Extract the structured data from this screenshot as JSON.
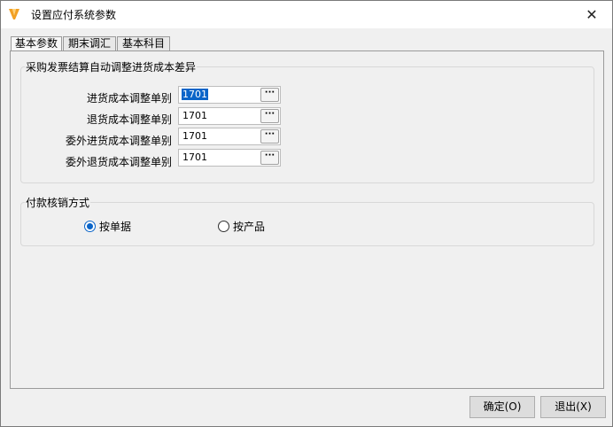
{
  "window": {
    "title": "设置应付系统参数",
    "close_glyph": "✕"
  },
  "tabs": [
    {
      "label": "基本参数",
      "active": true
    },
    {
      "label": "期末调汇",
      "active": false
    },
    {
      "label": "基本科目",
      "active": false
    }
  ],
  "invoice_group": {
    "title": "采购发票结算自动调整进货成本差异",
    "fields": [
      {
        "label": "进货成本调整单别",
        "value": "1701",
        "selected": true
      },
      {
        "label": "退货成本调整单别",
        "value": "1701",
        "selected": false
      },
      {
        "label": "委外进货成本调整单别",
        "value": "1701",
        "selected": false
      },
      {
        "label": "委外退货成本调整单别",
        "value": "1701",
        "selected": false
      }
    ],
    "browse_glyph": "···"
  },
  "payment_group": {
    "title": "付款核销方式",
    "options": [
      {
        "label": "按单据",
        "checked": true
      },
      {
        "label": "按产品",
        "checked": false
      }
    ]
  },
  "footer": {
    "ok_label": "确定(O)",
    "exit_label": "退出(X)"
  },
  "colors": {
    "accent": "#0a64c8",
    "icon_orange": "#f2a024"
  }
}
